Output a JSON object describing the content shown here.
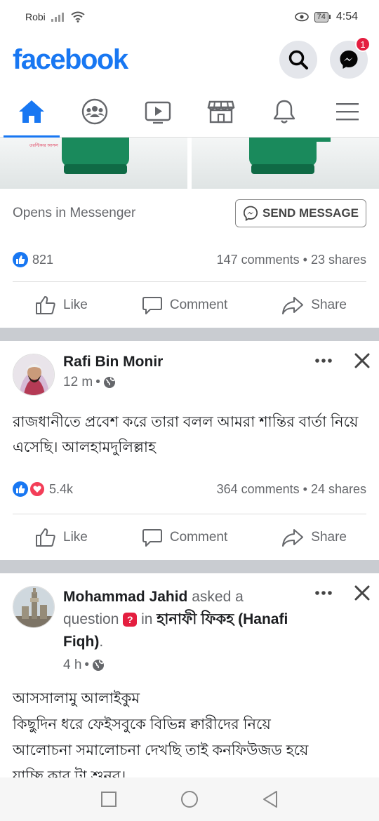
{
  "status_bar": {
    "carrier": "Robi",
    "battery": "74",
    "time": "4:54"
  },
  "header": {
    "logo": "facebook",
    "messenger_badge": "1"
  },
  "nav": {
    "tabs": [
      "home",
      "groups",
      "watch",
      "marketplace",
      "notifications",
      "menu"
    ]
  },
  "ad_post": {
    "image_tag": "তরল্টিকার আসল",
    "cta_text": "Opens in Messenger",
    "cta_button": "SEND MESSAGE",
    "reaction_count": "821",
    "comments": "147 comments",
    "shares": "23 shares"
  },
  "actions": {
    "like": "Like",
    "comment": "Comment",
    "share": "Share"
  },
  "post1": {
    "author": "Rafi Bin Monir",
    "time": "12 m",
    "text": "রাজধানীতে প্রবেশ করে তারা বলল আমরা শান্তির বার্তা নিয়ে এসেছি। আলহামদুলিল্লাহ",
    "reaction_count": "5.4k",
    "comments": "364 comments",
    "shares": "24 shares"
  },
  "post2": {
    "author": "Mohammad Jahid",
    "verb": "asked a",
    "question_word": "question",
    "in_word": "in",
    "group": "হানাফী ফিকহ (Hanafi Fiqh)",
    "time": "4 h",
    "text_lines": [
      "আসসালামু আলাইকুম",
      "কিছুদিন ধরে ফেইসবুকে বিভিন্ন ক্বারীদের নিয়ে",
      "আলোচনা সমালোচনা দেখছি তাই কনফিউজড হয়ে",
      "যাচ্ছি কার টা শুনব।"
    ]
  },
  "colors": {
    "brand": "#1877f2",
    "separator": "#c9ccd1",
    "muted": "#65676b"
  }
}
